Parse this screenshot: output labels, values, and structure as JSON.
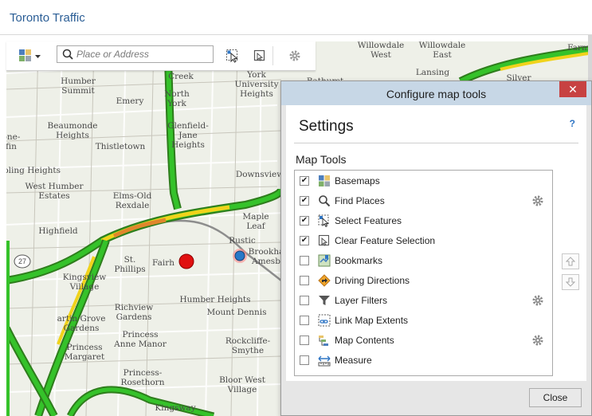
{
  "app": {
    "title": "Toronto Traffic"
  },
  "toolbar": {
    "basemap_icon": "basemap-grid-icon",
    "search_placeholder": "Place or Address",
    "select_icon": "select-features-icon",
    "clear_icon": "clear-selection-icon",
    "settings_icon": "gear-icon"
  },
  "map": {
    "labels": [
      {
        "text": "Willowdale\nWest"
      },
      {
        "text": "Willowdale\nEast"
      },
      {
        "text": "Farm"
      },
      {
        "text": "Lansing"
      },
      {
        "text": "Silver"
      },
      {
        "text": "Humber\nSummit"
      },
      {
        "text": "Creek"
      },
      {
        "text": "York\nUniversity\nHeights"
      },
      {
        "text": "Bathurst"
      },
      {
        "text": "Emery"
      },
      {
        "text": "North\nYork"
      },
      {
        "text": "Beaumonde\nHeights"
      },
      {
        "text": "Glenfield-\nJane\nHeights"
      },
      {
        "text": "Thistletown"
      },
      {
        "text": "one-\nfin"
      },
      {
        "text": "pling Heights"
      },
      {
        "text": "Downsview"
      },
      {
        "text": "West Humber\nEstates"
      },
      {
        "text": "Elms-Old\nRexdale"
      },
      {
        "text": "Maple\nLeaf"
      },
      {
        "text": "Highfield"
      },
      {
        "text": "Rustic"
      },
      {
        "text": "Brookha\nAmesb"
      },
      {
        "text": "St.\nPhillips"
      },
      {
        "text": "Fairh"
      },
      {
        "text": "Kingsview\nVillage"
      },
      {
        "text": "Humber Heights"
      },
      {
        "text": "Richview\nGardens"
      },
      {
        "text": "Mount Dennis"
      },
      {
        "text": "artin Grove\nGardens"
      },
      {
        "text": "Princess\nAnne Manor"
      },
      {
        "text": "Princess\nMargaret"
      },
      {
        "text": "Rockcliffe-\nSmythe"
      },
      {
        "text": "Princess-\nRosethorn"
      },
      {
        "text": "Bloor West\nVillage"
      },
      {
        "text": "Kingsway"
      },
      {
        "text": "27"
      }
    ]
  },
  "dialog": {
    "title": "Configure map tools",
    "close_icon": "close-x-icon",
    "close_glyph": "✕",
    "heading": "Settings",
    "help": "?",
    "section_label": "Map Tools",
    "tools": [
      {
        "label": "Basemaps",
        "checked": true,
        "icon": "basemaps-icon",
        "has_settings": false
      },
      {
        "label": "Find Places",
        "checked": true,
        "icon": "search-icon",
        "has_settings": true
      },
      {
        "label": "Select Features",
        "checked": true,
        "icon": "select-features-icon",
        "has_settings": false
      },
      {
        "label": "Clear Feature Selection",
        "checked": true,
        "icon": "clear-selection-icon",
        "has_settings": false
      },
      {
        "label": "Bookmarks",
        "checked": false,
        "icon": "bookmarks-icon",
        "has_settings": false
      },
      {
        "label": "Driving Directions",
        "checked": false,
        "icon": "directions-icon",
        "has_settings": false
      },
      {
        "label": "Layer Filters",
        "checked": false,
        "icon": "filter-icon",
        "has_settings": true
      },
      {
        "label": "Link Map Extents",
        "checked": false,
        "icon": "link-extents-icon",
        "has_settings": false
      },
      {
        "label": "Map Contents",
        "checked": false,
        "icon": "map-contents-icon",
        "has_settings": true
      },
      {
        "label": "Measure",
        "checked": false,
        "icon": "measure-icon",
        "has_settings": false
      }
    ],
    "move_up_icon": "arrow-up-icon",
    "move_down_icon": "arrow-down-icon",
    "close_button": "Close"
  }
}
